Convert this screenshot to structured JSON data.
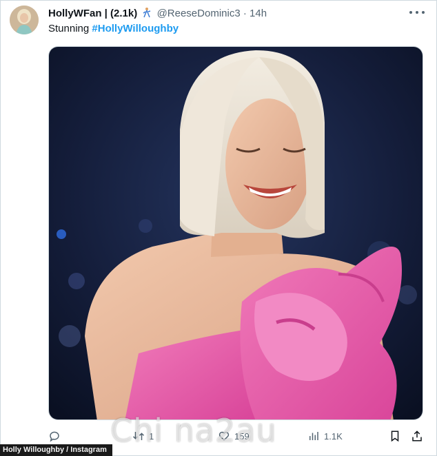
{
  "tweet": {
    "display_name": "HollyWFan | (2.1k)",
    "handle": "@ReeseDominic3",
    "separator": "·",
    "time": "14h",
    "text_prefix": "Stunning",
    "hashtag": "#HollyWilloughby"
  },
  "actions": {
    "reply_count": "",
    "retweet_count": "1",
    "like_count": "159",
    "views_count": "1.1K"
  },
  "credit": "Holly Willoughby / Instagram",
  "watermark": "Chi na2au",
  "colors": {
    "link": "#1d9bf0",
    "dress": "#e85aa8",
    "muted": "#536471"
  },
  "icons": [
    "more-icon",
    "reply-icon",
    "retweet-icon",
    "like-icon",
    "views-icon",
    "bookmark-icon",
    "share-icon"
  ]
}
